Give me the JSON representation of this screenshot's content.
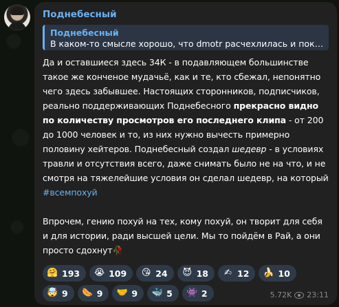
{
  "channel": {
    "sender_name": "Поднебесный"
  },
  "reply": {
    "author": "Поднебесный",
    "text": "В каком-то смысле хорошо, что dmotr расчехлилась и пока..."
  },
  "message": {
    "p1_part1": "Да и оставшиеся здесь 34К - в подавляющем большинстве такое же конченое мудачьё, как и те, кто сбежал, непонятно чего здесь забывшее. Настоящих сторонников, подписчиков, реально поддерживающих Поднебесного ",
    "p1_bold": "прекрасно видно по количеству просмотров его последнего клипа",
    "p1_part2": " - от 200 до 1000 человек и то, из них нужно вычесть примерно половину хейтеров. Поднебесный создал ",
    "p1_italic": "шедевр",
    "p1_part3": " - в условиях травли и отсутствия всего, даже снимать было не на что, и не смотря на тяжелейшие условия он сделал шедевр, на который",
    "hashtag": "#всемпохуй",
    "p2": "Впрочем, гению похуй на тех, кому похуй, он творит для себя и для истории, ради высшей цели. Мы то пойдём в Рай, а они просто сдохнут🥀"
  },
  "reactions": [
    {
      "emoji": "🤗",
      "count": "193"
    },
    {
      "emoji": "😭",
      "count": "109"
    },
    {
      "emoji": "😘",
      "count": "24"
    },
    {
      "emoji": "😈",
      "count": "18"
    },
    {
      "emoji": "✍",
      "count": "12"
    },
    {
      "emoji": "🍌",
      "count": "10"
    },
    {
      "emoji": "🤯",
      "count": "9"
    },
    {
      "emoji": "🌭",
      "count": "9"
    },
    {
      "emoji": "🤝",
      "count": "9"
    },
    {
      "emoji": "🐳",
      "count": "5"
    },
    {
      "emoji": "👾",
      "count": "2"
    }
  ],
  "meta": {
    "views": "5.72K",
    "time": "23:11"
  },
  "colors": {
    "accent": "#6ab2f2",
    "bubble": "#212121",
    "reaction_bg": "#2f3a49"
  }
}
